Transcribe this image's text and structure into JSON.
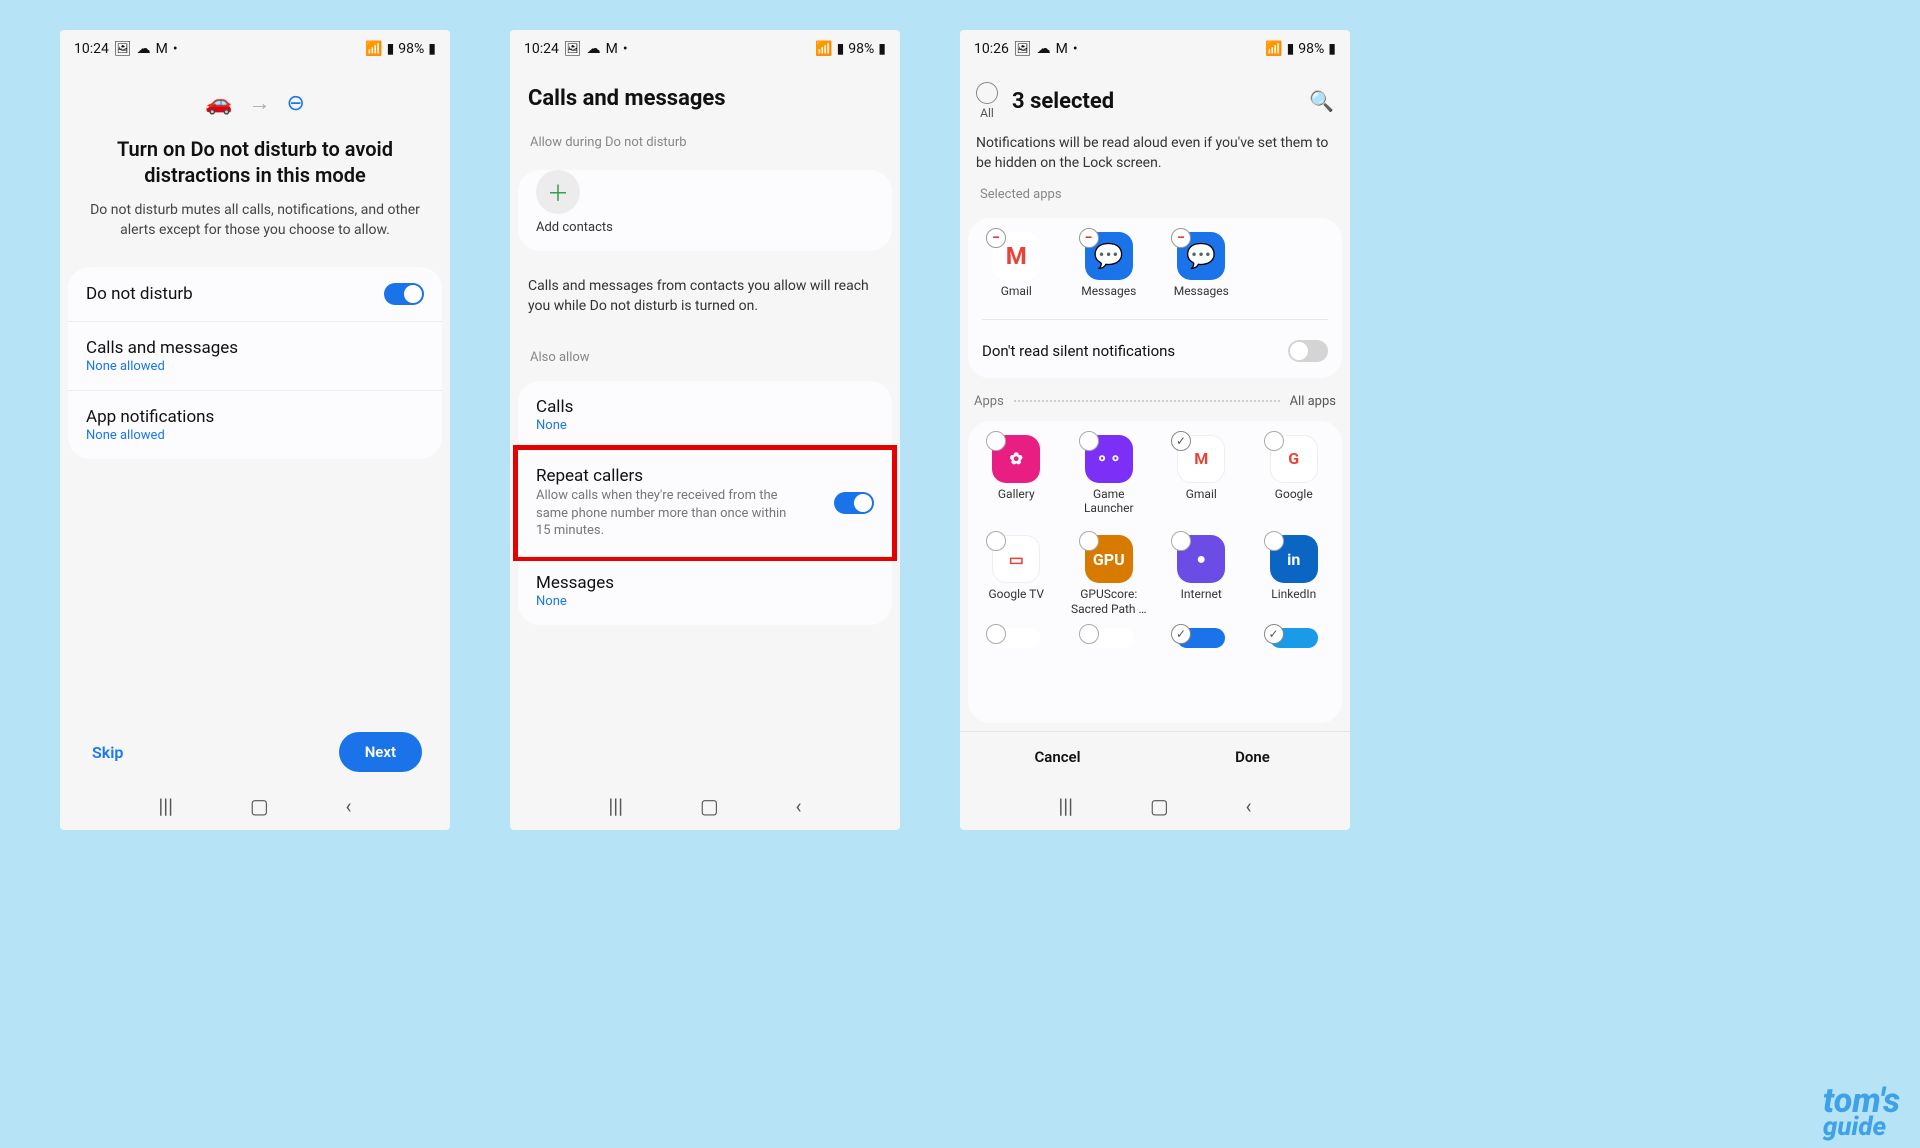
{
  "status": {
    "time1": "10:24",
    "time2": "10:24",
    "time3": "10:26",
    "battery": "98%"
  },
  "screen1": {
    "title": "Turn on Do not disturb to avoid distractions in this mode",
    "desc": "Do not disturb mutes all calls, notifications, and other alerts except for those you choose to allow.",
    "dnd_label": "Do not disturb",
    "calls_label": "Calls and messages",
    "calls_sub": "None allowed",
    "apps_label": "App notifications",
    "apps_sub": "None allowed",
    "skip": "Skip",
    "next": "Next"
  },
  "screen2": {
    "title": "Calls and messages",
    "allow_label": "Allow during Do not disturb",
    "add_contacts": "Add contacts",
    "info": "Calls and messages from contacts you allow will reach you while Do not disturb is turned on.",
    "also_allow": "Also allow",
    "calls_label": "Calls",
    "calls_sub": "None",
    "repeat_label": "Repeat callers",
    "repeat_desc": "Allow calls when they're received from the same phone number more than once within 15 minutes.",
    "msgs_label": "Messages",
    "msgs_sub": "None"
  },
  "screen3": {
    "all": "All",
    "title": "3 selected",
    "notice": "Notifications will be read aloud even if you've set them to be hidden on the Lock screen.",
    "selected_label": "Selected apps",
    "selected_apps": [
      {
        "name": "Gmail",
        "bg": "#fff",
        "fg": "#ea4335",
        "letter": "M"
      },
      {
        "name": "Messages",
        "bg": "#1a73e8",
        "fg": "#fff",
        "letter": "💬"
      },
      {
        "name": "Messages",
        "bg": "#1a73e8",
        "fg": "#fff",
        "letter": "💬"
      }
    ],
    "silent_label": "Don't read silent notifications",
    "apps_label": "Apps",
    "all_apps_label": "All apps",
    "apps": [
      {
        "name": "Gallery",
        "bg": "#e91e82",
        "letter": "✿",
        "checked": false
      },
      {
        "name": "Game Launcher",
        "bg": "#7b2ff7",
        "letter": "⚬⚬",
        "checked": false
      },
      {
        "name": "Gmail",
        "bg": "#fff",
        "letter": "M",
        "checked": true
      },
      {
        "name": "Google",
        "bg": "#fff",
        "letter": "G",
        "checked": false
      },
      {
        "name": "Google TV",
        "bg": "#fff",
        "letter": "▭",
        "checked": false
      },
      {
        "name": "GPUScore: Sacred Path …",
        "bg": "#d97a00",
        "letter": "GPU",
        "checked": false
      },
      {
        "name": "Internet",
        "bg": "#6b4de6",
        "letter": "●",
        "checked": false
      },
      {
        "name": "LinkedIn",
        "bg": "#0a66c2",
        "letter": "in",
        "checked": false
      }
    ],
    "cancel": "Cancel",
    "done": "Done"
  },
  "watermark": {
    "line1": "tom's",
    "line2": "guide"
  }
}
